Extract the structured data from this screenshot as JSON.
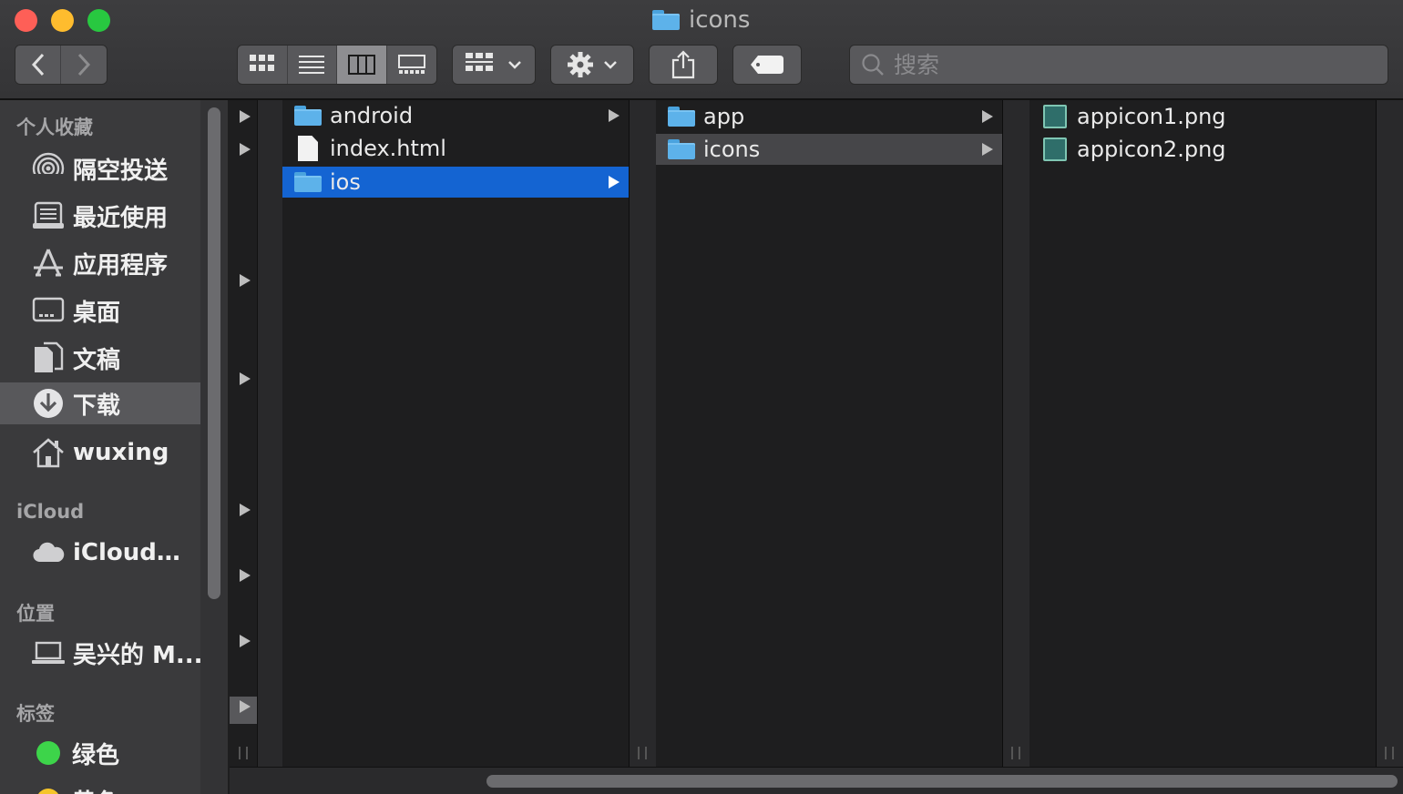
{
  "window": {
    "title": "icons"
  },
  "toolbar": {
    "search_placeholder": "搜索"
  },
  "sidebar": {
    "sections": {
      "favorites": "个人收藏",
      "icloud": "iCloud",
      "locations": "位置",
      "tags": "标签"
    },
    "favorites": [
      {
        "label": "隔空投送",
        "icon": "airdrop-icon"
      },
      {
        "label": "最近使用",
        "icon": "recents-icon"
      },
      {
        "label": "应用程序",
        "icon": "applications-icon"
      },
      {
        "label": "桌面",
        "icon": "desktop-icon"
      },
      {
        "label": "文稿",
        "icon": "documents-icon"
      },
      {
        "label": "下载",
        "icon": "downloads-icon",
        "selected": true
      },
      {
        "label": "wuxing",
        "icon": "home-icon"
      }
    ],
    "icloud": [
      {
        "label": "iCloud…",
        "icon": "cloud-icon"
      }
    ],
    "locations": [
      {
        "label": "吴兴的 M...",
        "icon": "laptop-icon"
      }
    ],
    "tags": [
      {
        "label": "绿色",
        "color": "#3dd44a"
      },
      {
        "label": "黄色",
        "color": "#f5c52a"
      }
    ]
  },
  "columns": [
    [
      {
        "name": "android",
        "type": "folder",
        "has_children": true
      },
      {
        "name": "index.html",
        "type": "file",
        "has_children": false
      },
      {
        "name": "ios",
        "type": "folder",
        "has_children": true,
        "selected": true
      }
    ],
    [
      {
        "name": "app",
        "type": "folder",
        "has_children": true
      },
      {
        "name": "icons",
        "type": "folder",
        "has_children": true,
        "selected": true
      }
    ],
    [
      {
        "name": "appicon1.png",
        "type": "image"
      },
      {
        "name": "appicon2.png",
        "type": "image"
      }
    ]
  ],
  "colors": {
    "selection": "#1464d2",
    "folder": "#5db2ea"
  }
}
